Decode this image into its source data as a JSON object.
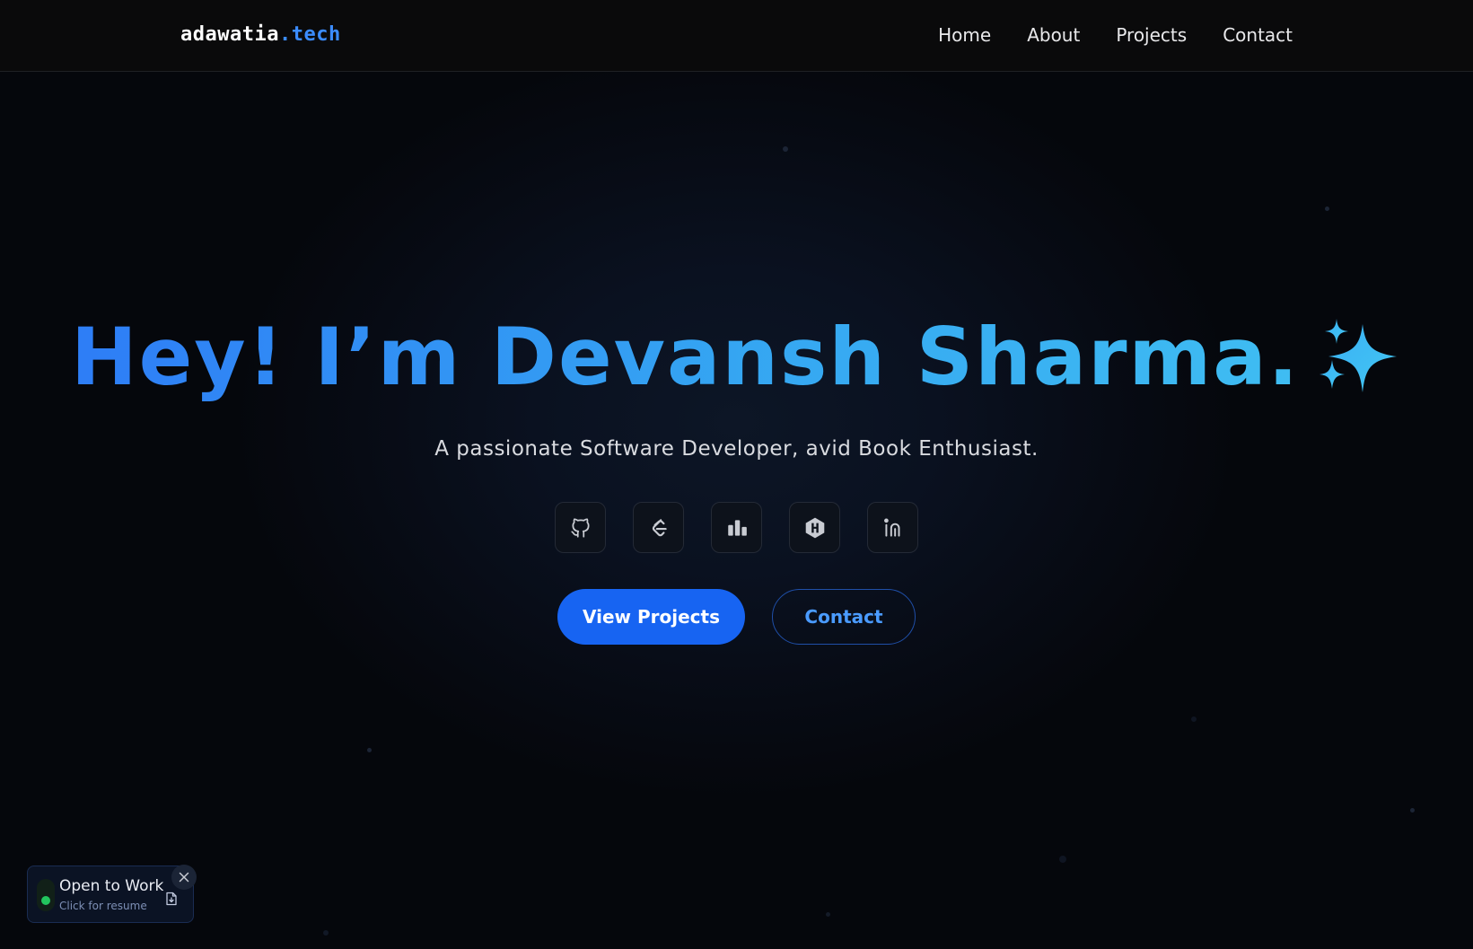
{
  "header": {
    "logo_main": "adawatia",
    "logo_tld": ".tech",
    "nav": [
      {
        "label": "Home"
      },
      {
        "label": "About"
      },
      {
        "label": "Projects"
      },
      {
        "label": "Contact"
      }
    ]
  },
  "hero": {
    "title": "Hey! I’m Devansh Sharma.",
    "sparkle_icon": "sparkles-icon",
    "subtitle": "A passionate Software Developer, avid Book Enthusiast.",
    "socials": [
      {
        "icon": "github-icon"
      },
      {
        "icon": "leetcode-icon"
      },
      {
        "icon": "bar-chart-icon"
      },
      {
        "icon": "hashnode-icon"
      },
      {
        "icon": "linkedin-icon"
      }
    ],
    "primary_button": "View Projects",
    "secondary_button": "Contact"
  },
  "toast": {
    "title": "Open to Work",
    "subtitle": "Click for resume"
  },
  "colors": {
    "background": "#05070c",
    "header_bg": "#0a0a0b",
    "accent": "#1764f2",
    "logo_accent": "#3b8cff",
    "title_gradient_start": "#2e7df6",
    "title_gradient_end": "#3fbdf2",
    "status_green": "#22c55e"
  }
}
